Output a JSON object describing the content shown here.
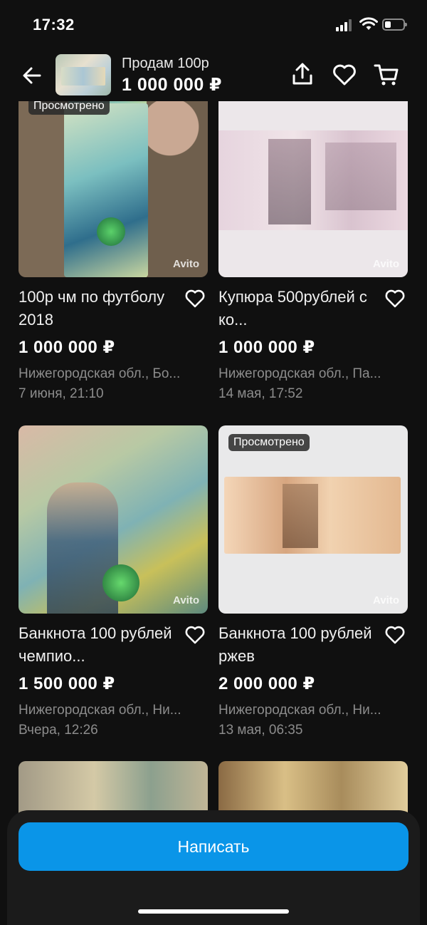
{
  "status_bar": {
    "time": "17:32"
  },
  "header": {
    "title": "Продам 100р",
    "price": "1 000 000 ₽"
  },
  "listings": [
    {
      "badge": "Просмотрено",
      "watermark": "Avito",
      "title": "100р чм по футболу 2018",
      "price": "1 000 000 ₽",
      "location": "Нижегородская обл., Бо...",
      "date": "7 июня, 21:10"
    },
    {
      "badge": "",
      "watermark": "Avito",
      "title": "Купюра 500рублей с ко...",
      "price": "1 000 000 ₽",
      "location": "Нижегородская обл., Па...",
      "date": "14 мая, 17:52"
    },
    {
      "badge": "",
      "watermark": "Avito",
      "title": "Банкнота 100 рублей чемпио...",
      "price": "1 500 000 ₽",
      "location": "Нижегородская обл., Ни...",
      "date": "Вчера, 12:26"
    },
    {
      "badge": "Просмотрено",
      "watermark": "Avito",
      "title": "Банкнота 100 рублей ржев",
      "price": "2 000 000 ₽",
      "location": "Нижегородская обл., Ни...",
      "date": "13 мая, 06:35"
    }
  ],
  "bottom": {
    "write_button": "Написать"
  }
}
